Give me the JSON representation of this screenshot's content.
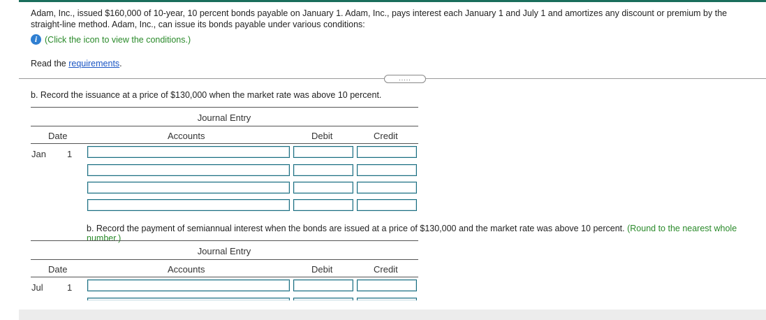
{
  "intro": {
    "paragraph": "Adam, Inc., issued $160,000 of 10-year, 10 percent bonds payable on January 1. Adam, Inc., pays interest each January 1 and July 1 and amortizes any discount or premium by the straight-line method. Adam, Inc., can issue its bonds payable under various conditions:",
    "info_text": "(Click the icon to view the conditions.)",
    "read_prefix": "Read the ",
    "read_link": "requirements",
    "read_suffix": ".",
    "more_button": "....."
  },
  "part1": {
    "question": "b. Record the issuance at a price of $130,000 when the market rate was above 10 percent.",
    "table_title": "Journal Entry",
    "headers": {
      "date": "Date",
      "accounts": "Accounts",
      "debit": "Debit",
      "credit": "Credit"
    },
    "month": "Jan",
    "day": "1"
  },
  "part2": {
    "question": "b. Record the payment of semiannual interest when the bonds are issued at a price of $130,000 and the market rate was above 10 percent.",
    "hint": "(Round to the nearest whole number.)",
    "table_title": "Journal Entry",
    "headers": {
      "date": "Date",
      "accounts": "Accounts",
      "debit": "Debit",
      "credit": "Credit"
    },
    "month": "Jul",
    "day": "1"
  },
  "colors": {
    "accent": "#1a6e5c",
    "link": "#1a55c4",
    "hint": "#2a8a2a",
    "input_border": "#1a6e80"
  }
}
